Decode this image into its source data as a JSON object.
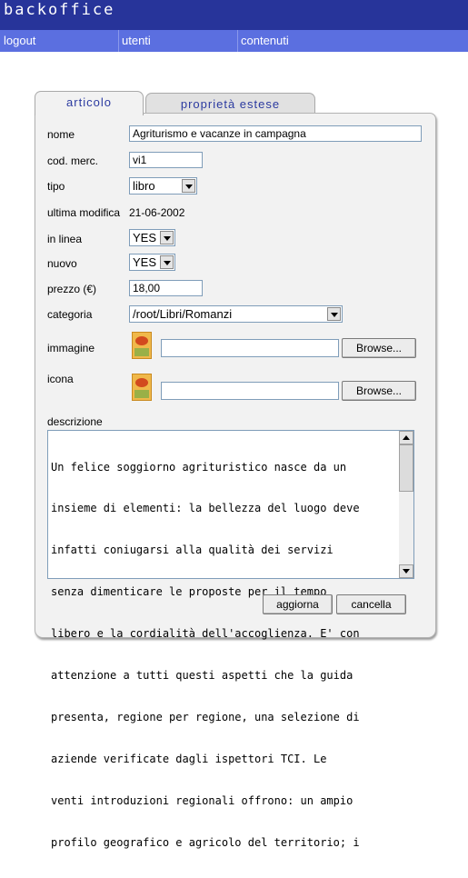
{
  "app": {
    "title": "backoffice"
  },
  "nav": {
    "items": [
      {
        "label": "logout"
      },
      {
        "label": "utenti"
      },
      {
        "label": "contenuti"
      }
    ]
  },
  "tabs": [
    {
      "label": "articolo",
      "active": true
    },
    {
      "label": "proprietà estese",
      "active": false
    }
  ],
  "form": {
    "nome": {
      "label": "nome",
      "value": "Agriturismo e vacanze in campagna"
    },
    "cod_merc": {
      "label": "cod. merc.",
      "value": "vi1"
    },
    "tipo": {
      "label": "tipo",
      "value": "libro"
    },
    "ultima_modifica": {
      "label": "ultima modifica",
      "value": "21-06-2002"
    },
    "in_linea": {
      "label": "in linea",
      "value": "YES"
    },
    "nuovo": {
      "label": "nuovo",
      "value": "YES"
    },
    "prezzo": {
      "label": "prezzo (€)",
      "value": "18,00"
    },
    "categoria": {
      "label": "categoria",
      "value": "/root/Libri/Romanzi"
    },
    "immagine": {
      "label": "immagine",
      "browse": "Browse...",
      "value": ""
    },
    "icona": {
      "label": "icona",
      "browse": "Browse...",
      "value": ""
    },
    "descrizione": {
      "label": "descrizione",
      "lines": [
        "Un felice soggiorno agrituristico nasce da un",
        "insieme di elementi: la bellezza del luogo deve",
        "infatti coniugarsi alla qualità dei servizi",
        "senza dimenticare le proposte per il tempo",
        "libero e la cordialità dell'accoglienza. E' con",
        "attenzione a tutti questi aspetti che la guida",
        "presenta, regione per regione, una selezione di",
        "aziende verificate dagli ispettori TCI. Le",
        "venti introduzioni regionali offrono: un ampio",
        "profilo geografico e agricolo del territorio; i"
      ]
    }
  },
  "actions": {
    "save": "aggiorna",
    "cancel": "cancella"
  },
  "colors": {
    "topbar": "#27349a",
    "nav": "#5b6fe0",
    "tab_text": "#2b3aa0",
    "panel": "#f2f2f2"
  },
  "icons": {
    "thumbnail": "book-cover-thumbnail",
    "dropdown": "chevron-down-icon"
  }
}
